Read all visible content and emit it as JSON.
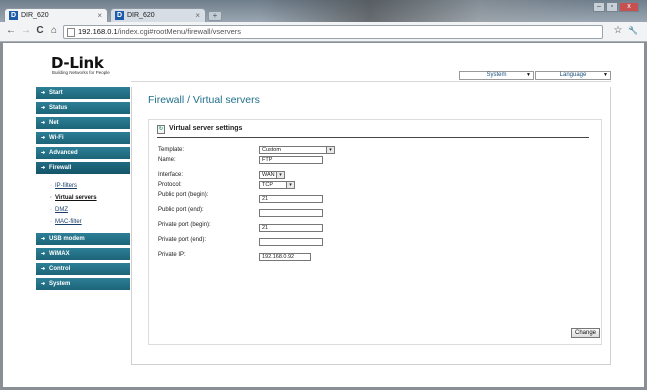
{
  "browser": {
    "tabs": [
      {
        "label": "DIR_620",
        "active": true
      },
      {
        "label": "DIR_620",
        "active": false
      }
    ],
    "new_tab": "+",
    "window_controls": [
      "–",
      "▫",
      "x"
    ],
    "url_host": "192.168.0.1",
    "url_path": "/index.cgi#rootMenu/firewall/vservers",
    "nav": {
      "back": "←",
      "forward": "→",
      "reload": "C",
      "home": "⌂",
      "star": "☆",
      "wrench": "🔧"
    }
  },
  "header": {
    "logo": "D-Link",
    "tagline": "Building Networks for People",
    "system_label": "System",
    "language_label": "Language"
  },
  "menu": {
    "items": [
      {
        "label": "Start"
      },
      {
        "label": "Status"
      },
      {
        "label": "Net"
      },
      {
        "label": "Wi-Fi"
      },
      {
        "label": "Advanced"
      },
      {
        "label": "Firewall"
      },
      {
        "label": "USB modem"
      },
      {
        "label": "WiMAX"
      },
      {
        "label": "Control"
      },
      {
        "label": "System"
      }
    ],
    "firewall_sub": [
      "IP-filters",
      "Virtual servers",
      "DMZ",
      "MAC-filter"
    ]
  },
  "main": {
    "title": "Firewall / Virtual servers",
    "panel_title": "Virtual server settings",
    "fields": {
      "template_label": "Template:",
      "template_value": "Custom",
      "name_label": "Name:",
      "name_value": "FTP",
      "interface_label": "Interface:",
      "interface_value": "WAN",
      "protocol_label": "Protocol:",
      "protocol_value": "TCP",
      "public_begin_label": "Public port (begin):",
      "public_begin_value": "21",
      "public_end_label": "Public port (end):",
      "public_end_value": "",
      "private_begin_label": "Private port (begin):",
      "private_begin_value": "21",
      "private_end_label": "Private port (end):",
      "private_end_value": "",
      "private_ip_label": "Private IP:",
      "private_ip_value": "192.168.0.92"
    },
    "change_button": "Change"
  }
}
